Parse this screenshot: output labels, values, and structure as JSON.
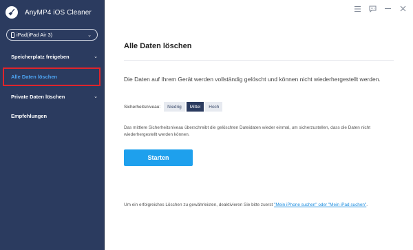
{
  "app": {
    "title": "AnyMP4 iOS Cleaner"
  },
  "device_select": {
    "value": "iPad(iPad Air 3)"
  },
  "sidebar": {
    "items": [
      {
        "label": "Speicherplatz freigeben",
        "has_chevron": true,
        "active": false
      },
      {
        "label": "Alle Daten löschen",
        "has_chevron": false,
        "active": true
      },
      {
        "label": "Private Daten löschen",
        "has_chevron": true,
        "active": false
      },
      {
        "label": "Empfehlungen",
        "has_chevron": false,
        "active": false
      }
    ]
  },
  "topbar": {
    "icons": [
      "menu-icon",
      "feedback-icon",
      "minimize-icon",
      "close-icon"
    ]
  },
  "main": {
    "title": "Alle Daten löschen",
    "description": "Die Daten auf Ihrem Gerät werden vollständig gelöscht und können nicht wiederhergestellt werden.",
    "security_label": "Sicherheitsniveau:",
    "levels": [
      "Niedrig",
      "Mittel",
      "Hoch"
    ],
    "selected_level": "Mittel",
    "level_description": "Das mittlere Sicherheitsniveau überschreibt die gelöschten Dateidaten wieder einmal, um sicherzustellen, dass die Daten nicht wiederhergestellt werden können.",
    "start_label": "Starten",
    "footer_prefix": "Um ein erfolgreiches Löschen zu gewährleisten, deaktivieren Sie bitte zuerst ",
    "footer_link": "\"Mein iPhone suchen\" oder \"Mein iPad suchen\"",
    "footer_suffix": "."
  },
  "colors": {
    "sidebar_bg": "#2b3b5f",
    "accent": "#1ea0ed",
    "active_nav_text": "#4ea4f2",
    "active_border": "#e0242b"
  }
}
